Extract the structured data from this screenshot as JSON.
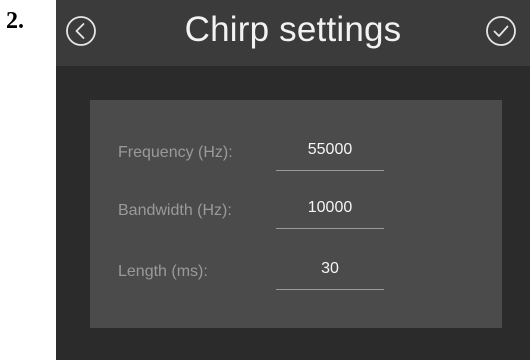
{
  "step_label": "2.",
  "titlebar": {
    "title": "Chirp settings",
    "back_icon": "chevron-left-circle-icon",
    "confirm_icon": "check-circle-icon"
  },
  "fields": [
    {
      "label": "Frequency (Hz):",
      "value": "55000"
    },
    {
      "label": "Bandwidth (Hz):",
      "value": "10000"
    },
    {
      "label": "Length (ms):",
      "value": "30"
    }
  ],
  "colors": {
    "screen_bg": "#2b2b2b",
    "titlebar_bg": "#3b3b3b",
    "panel_bg": "#4b4b4b",
    "label_text": "#9a9a9a",
    "value_text": "#f5f5f5",
    "title_text": "#f2f2f2"
  }
}
